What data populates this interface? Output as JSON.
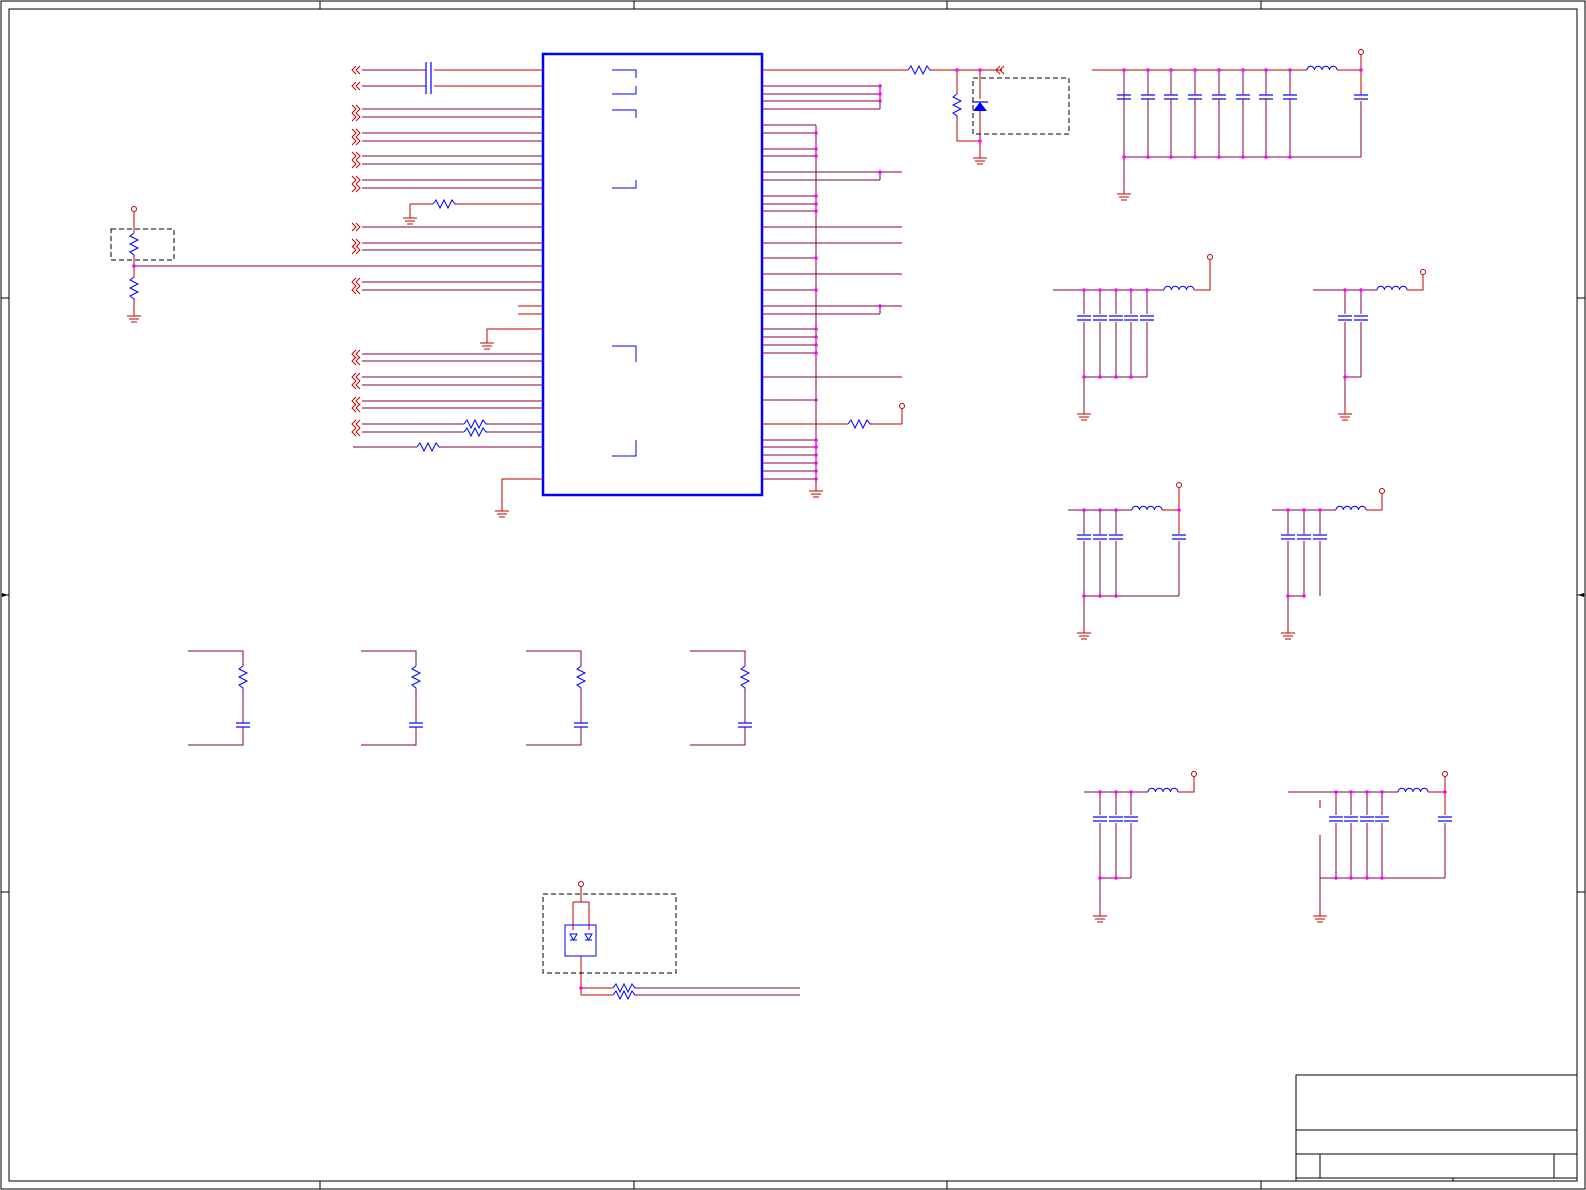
{
  "sheet": {
    "border_color": "#000000",
    "background": "#ffffff",
    "title_block": {
      "title": "",
      "sheet_number": "",
      "revision": ""
    }
  },
  "colors": {
    "wire": "#c00000",
    "wire_bus": "#800040",
    "component": "#0000ff",
    "junction": "#ff00ff",
    "ground": "#c00000",
    "power_port": "#c00000",
    "dashed_box": "#000000"
  },
  "schematic": {
    "main_ic": {
      "label": ""
    },
    "components": {
      "resistor": "resistor-icon",
      "capacitor": "capacitor-icon",
      "inductor": "inductor-icon",
      "ground": "ground-icon",
      "power_port": "power-port-icon",
      "led": "led-icon",
      "diode": "diode-icon",
      "off_sheet_connector": "off-sheet-connector-icon"
    }
  }
}
